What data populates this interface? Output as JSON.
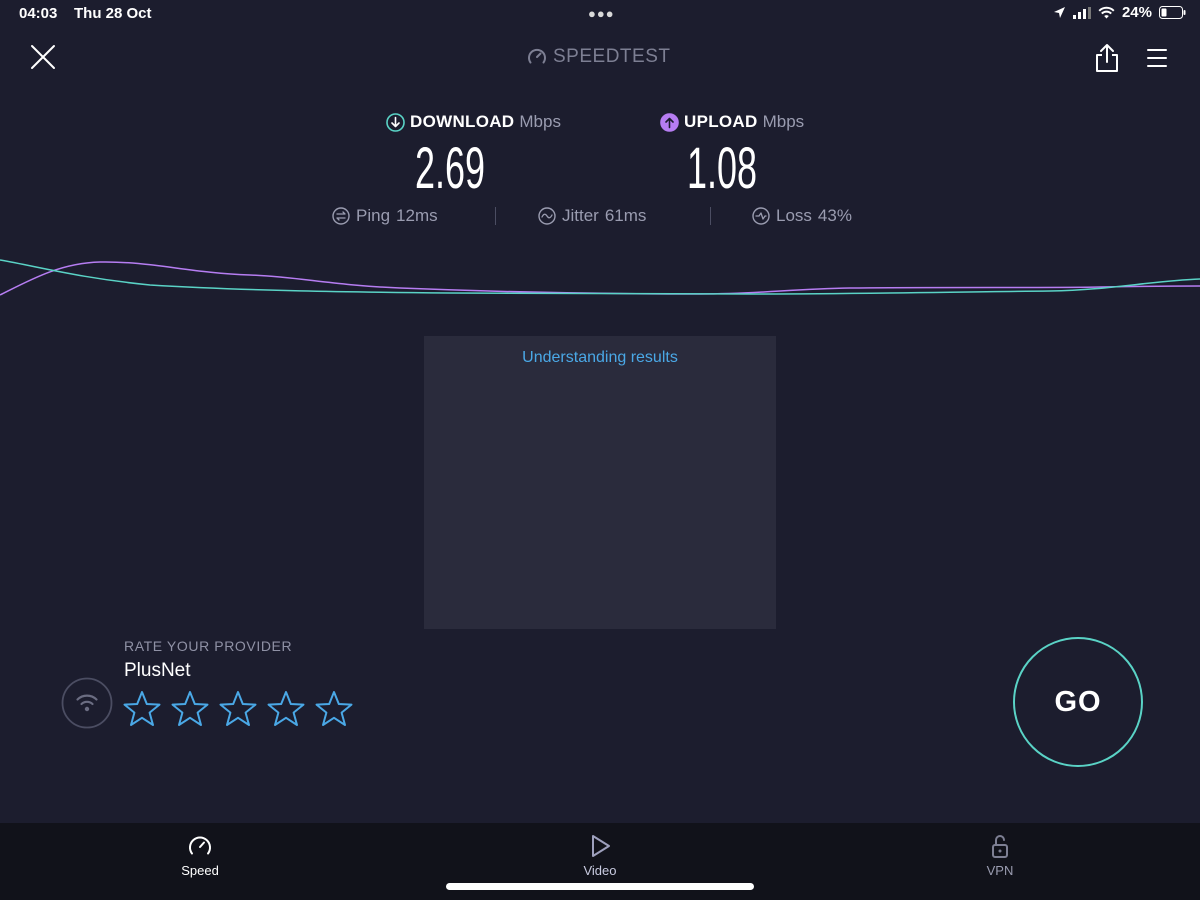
{
  "status_bar": {
    "time": "04:03",
    "date": "Thu 28 Oct",
    "battery": "24%"
  },
  "header": {
    "title": "SPEEDTEST"
  },
  "results": {
    "download": {
      "label": "DOWNLOAD",
      "unit": "Mbps",
      "value": "2.69"
    },
    "upload": {
      "label": "UPLOAD",
      "unit": "Mbps",
      "value": "1.08"
    },
    "ping": {
      "label": "Ping",
      "value": "12ms"
    },
    "jitter": {
      "label": "Jitter",
      "value": "61ms"
    },
    "loss": {
      "label": "Loss",
      "value": "43%"
    }
  },
  "ad_panel": {
    "link_text": "Understanding results"
  },
  "provider": {
    "rate_label": "RATE YOUR PROVIDER",
    "name": "PlusNet",
    "rating": 0,
    "max_rating": 5
  },
  "go_button": {
    "label": "GO"
  },
  "tabs": [
    {
      "label": "Speed",
      "icon": "speedometer-icon",
      "active": true
    },
    {
      "label": "Video",
      "icon": "play-icon",
      "active": false
    },
    {
      "label": "VPN",
      "icon": "unlock-icon",
      "active": false
    }
  ],
  "colors": {
    "background": "#1c1d2e",
    "download_accent": "#5ad3c6",
    "upload_accent": "#b67df2",
    "link": "#4aa8e6",
    "star": "#4aa8e6"
  }
}
